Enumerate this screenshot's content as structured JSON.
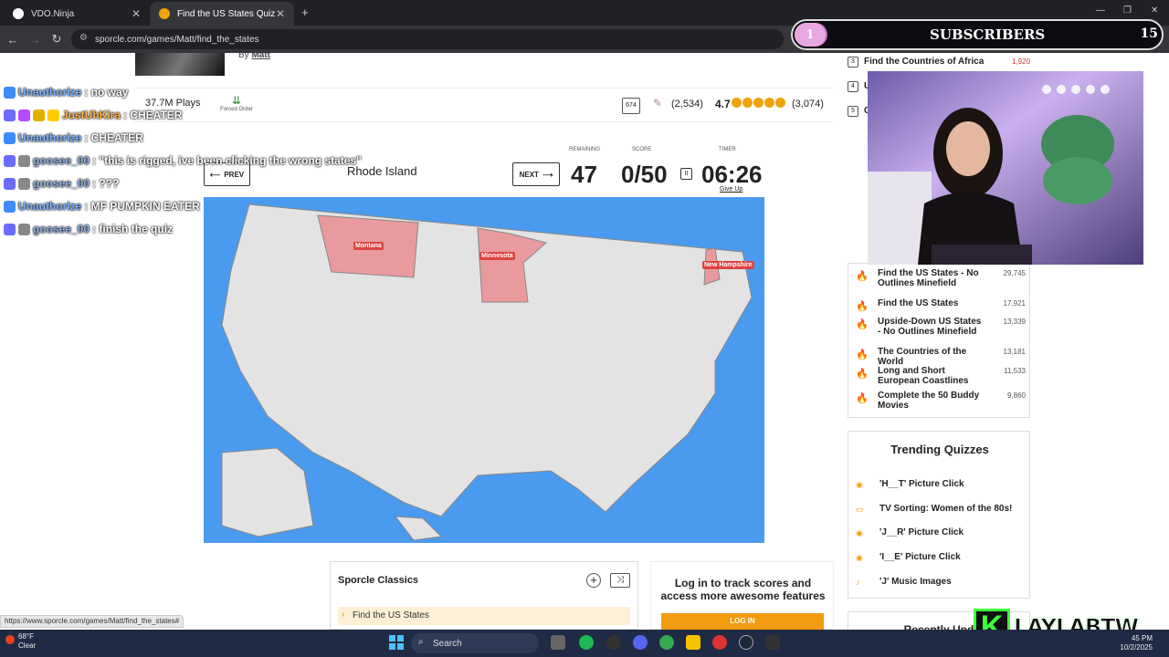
{
  "browser": {
    "tabs": [
      {
        "title": "VDO.Ninja"
      },
      {
        "title": "Find the US States Quiz"
      }
    ],
    "url": "sporcle.com/games/Matt/find_the_states",
    "status_url": "https://www.sporcle.com/games/Matt/find_the_states#"
  },
  "overlay": {
    "subscribers_label": "SUBSCRIBERS",
    "subscribers_progress": "1",
    "subscribers_count": "15",
    "streamer_name": "LAYLABTW",
    "streamer_badge": "K"
  },
  "chat": [
    {
      "user": "Unauthorize",
      "message": ": no way"
    },
    {
      "user": "JustUhKira",
      "message": ": CHEATER"
    },
    {
      "user": "Unauthorize",
      "message": ": CHEATER"
    },
    {
      "user": "goosee_00",
      "message": ": \"this is rigged, ive been clicking the wrong states\""
    },
    {
      "user": "goosee_00",
      "message": ": ???"
    },
    {
      "user": "Unauthorize",
      "message": ": MF PUMPKIN EATER"
    },
    {
      "user": "goosee_00",
      "message": ": finish the quiz"
    }
  ],
  "quiz": {
    "author_prefix": "By",
    "author": "Matt",
    "plays": "37.7M Plays",
    "forced_order": "Forced Order",
    "comments": "674",
    "rating_count_paren": "(2,534)",
    "rating": "4.7",
    "rating_votes": "(3,074)",
    "prev_label": "PREV",
    "next_label": "NEXT",
    "current_prompt": "Rhode Island",
    "remaining_label": "REMAINING",
    "remaining": "47",
    "score_label": "SCORE",
    "score": "0/50",
    "timer_label": "TIMER",
    "timer": "06:26",
    "give_up": "Give Up"
  },
  "map_labels": [
    {
      "name": "Montana"
    },
    {
      "name": "Minnesota"
    },
    {
      "name": "New Hampshire"
    }
  ],
  "classics": {
    "title": "Sporcle Classics",
    "first_item": "Find the US States"
  },
  "login": {
    "text": "Log in to track scores and access more awesome features",
    "button": "LOG IN"
  },
  "sidebar": {
    "top_list": [
      {
        "rank": "3",
        "title": "Find the Countries of Africa",
        "count": "1,920"
      },
      {
        "rank": "4",
        "title": "U"
      },
      {
        "rank": "5",
        "title": "C"
      }
    ],
    "popular": [
      {
        "title": "Find the US States - No Outlines Minefield",
        "count": "29,745"
      },
      {
        "title": "Find the US States",
        "count": "17,921"
      },
      {
        "title": "Upside-Down US States - No Outlines Minefield",
        "count": "13,339"
      },
      {
        "title": "The Countries of the World",
        "count": "13,181"
      },
      {
        "title": "Long and Short European Coastlines",
        "count": "11,533"
      },
      {
        "title": "Complete the 50 Buddy Movies",
        "count": "9,860"
      }
    ],
    "trending_title": "Trending Quizzes",
    "trending": [
      {
        "title": "'H__T' Picture Click"
      },
      {
        "title": "TV Sorting: Women of the 80s!"
      },
      {
        "title": "'J__R' Picture Click"
      },
      {
        "title": "'I__E' Picture Click"
      },
      {
        "title": "'J' Music Images"
      }
    ],
    "recently_title": "Recently Upd"
  },
  "taskbar": {
    "temp": "68°F",
    "weather": "Clear",
    "search": "Search",
    "time": "45 PM",
    "date": "10/2/2025"
  }
}
